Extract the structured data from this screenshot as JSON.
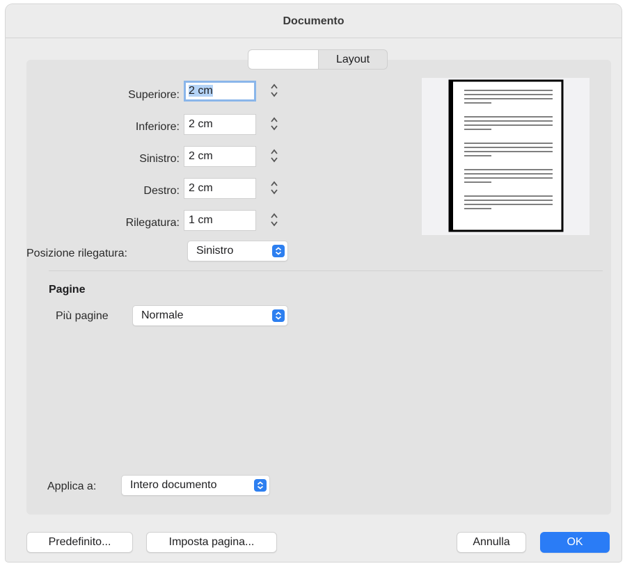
{
  "window": {
    "title": "Documento"
  },
  "tabs": [
    {
      "label": ""
    },
    {
      "label": "Layout"
    }
  ],
  "margins": {
    "top": {
      "label": "Superiore:",
      "value": "2 cm"
    },
    "bottom": {
      "label": "Inferiore:",
      "value": "2 cm"
    },
    "left": {
      "label": "Sinistro:",
      "value": "2 cm"
    },
    "right": {
      "label": "Destro:",
      "value": "2 cm"
    },
    "gutter": {
      "label": "Rilegatura:",
      "value": "1 cm"
    },
    "gutter_position": {
      "label": "Posizione rilegatura:",
      "value": "Sinistro"
    }
  },
  "pages": {
    "heading": "Pagine",
    "multiple_pages": {
      "label": "Più pagine",
      "value": "Normale"
    }
  },
  "apply_to": {
    "label": "Applica a:",
    "value": "Intero documento"
  },
  "buttons": {
    "default": "Predefinito...",
    "page_setup": "Imposta pagina...",
    "cancel": "Annulla",
    "ok": "OK"
  },
  "colors": {
    "accent": "#2a7cf6",
    "focus_ring": "#8ab6ea",
    "window_bg": "#ececec",
    "panel_bg": "#e3e3e3"
  },
  "icons": {
    "stepper": "stepper-updown-icon",
    "popup": "popup-chevrons-icon"
  }
}
